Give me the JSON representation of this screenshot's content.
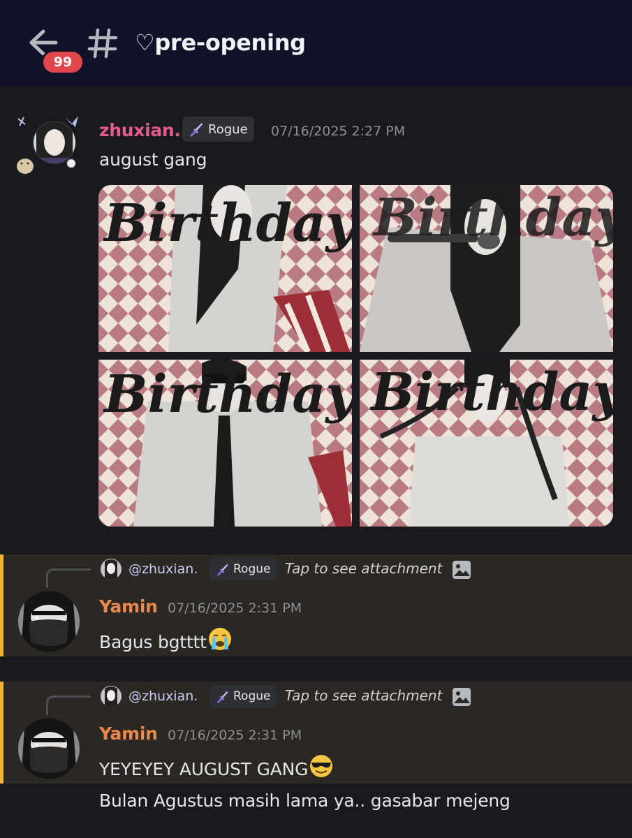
{
  "header": {
    "unread_badge": "99",
    "channel_name": "♡pre-opening",
    "icons": [
      "back-arrow-icon",
      "hash-icon"
    ]
  },
  "messages": [
    {
      "username": "zhuxian.",
      "username_color": "#e25c8c",
      "role": "Rogue",
      "timestamp": "07/16/2025 2:27 PM",
      "text": "august gang",
      "attachments": [
        "Birthday",
        "Birthday",
        "Birthday",
        "Birthday"
      ]
    },
    {
      "reply": {
        "mention": "@zhuxian.",
        "role": "Rogue",
        "hint": "Tap to see attachment"
      },
      "username": "Yamin",
      "username_color": "#e8894f",
      "timestamp": "07/16/2025 2:31 PM",
      "text": "Bagus bgtttt",
      "emoji": "loudly-crying-face"
    },
    {
      "reply": {
        "mention": "@zhuxian.",
        "role": "Rogue",
        "hint": "Tap to see attachment"
      },
      "username": "Yamin",
      "username_color": "#e8894f",
      "timestamp": "07/16/2025 2:31 PM",
      "text": "YEYEYEY AUGUST GANG",
      "emoji": "smiling-face-with-sunglasses",
      "text2": "Bulan Agustus masih lama ya.. gasabar mejeng"
    }
  ],
  "colors": {
    "header_bg": "#11112a",
    "chat_bg": "#1a1a1e",
    "reply_highlight": "#2b2723",
    "mention_bar": "#f0b232",
    "badge": "#e0474c"
  }
}
